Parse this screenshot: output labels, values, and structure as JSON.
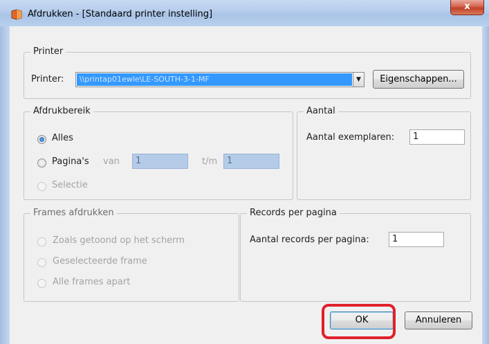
{
  "window": {
    "title": "Afdrukken - [Standaard printer instelling]",
    "close_label": "x"
  },
  "printer_group": {
    "legend": "Printer",
    "printer_label": "Printer:",
    "printer_value": "\\\\printap01ewle\\LE-SOUTH-3-1-MF",
    "properties_button": "Eigenschappen..."
  },
  "range_group": {
    "legend": "Afdrukbereik",
    "all_label": "Alles",
    "pages_label": "Pagina's",
    "from_label": "van",
    "from_value": "1",
    "to_label": "t/m",
    "to_value": "1",
    "selection_label": "Selectie",
    "selected": "Alles"
  },
  "count_group": {
    "legend": "Aantal",
    "copies_label": "Aantal exemplaren:",
    "copies_value": "1"
  },
  "frames_group": {
    "legend": "Frames afdrukken",
    "option1": "Zoals getoond op het scherm",
    "option2": "Geselecteerde frame",
    "option3": "Alle frames apart"
  },
  "records_group": {
    "legend": "Records per pagina",
    "records_label": "Aantal records per pagina:",
    "records_value": "1"
  },
  "buttons": {
    "ok": "OK",
    "cancel": "Annuleren"
  },
  "colors": {
    "selection_blue": "#3399ff",
    "highlight_red": "#e0202a",
    "close_red": "#c24026"
  }
}
